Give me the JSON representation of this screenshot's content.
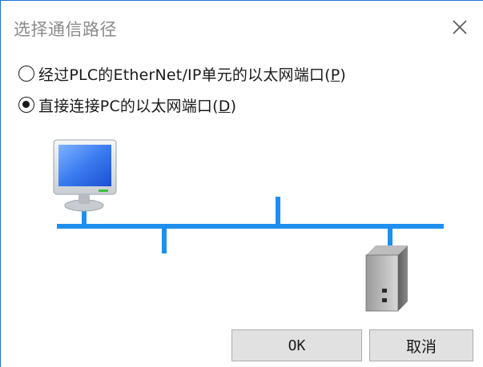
{
  "dialog": {
    "title": "选择通信路径"
  },
  "options": [
    {
      "label_prefix": "经过PLC的EtherNet/IP单元的以太网端口(",
      "mnemonic": "P",
      "label_suffix": ")",
      "selected": false
    },
    {
      "label_prefix": "直接连接PC的以太网端口(",
      "mnemonic": "D",
      "label_suffix": ")",
      "selected": true
    }
  ],
  "buttons": {
    "ok_label": "OK",
    "cancel_label": "取消"
  },
  "diagram": {
    "icons": [
      "monitor-icon",
      "pc-tower-icon"
    ],
    "network_color": "#1e8fef",
    "monitor_screen_color": "#2e6ce6"
  }
}
